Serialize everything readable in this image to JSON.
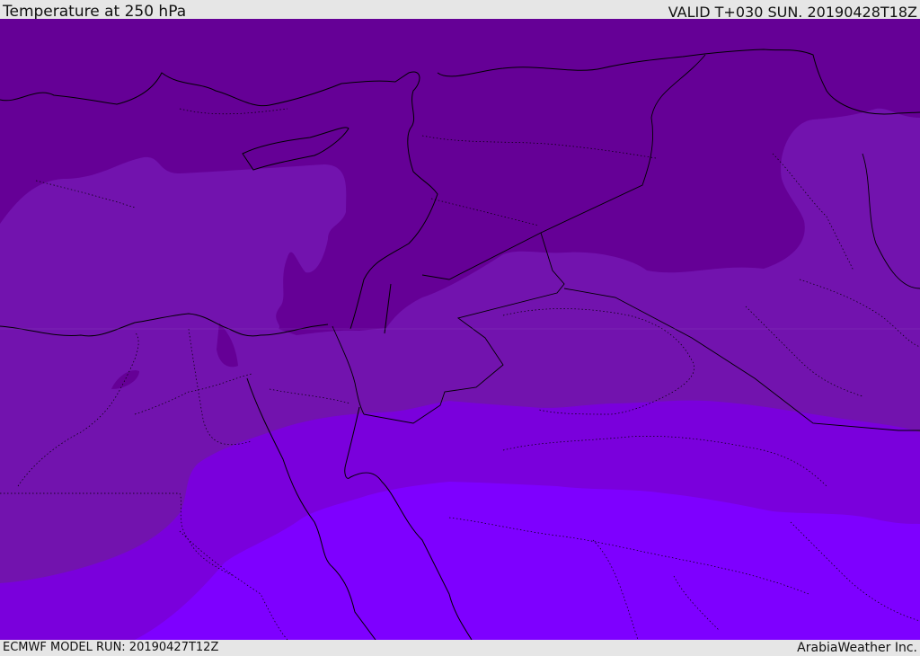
{
  "header": {
    "title": "Temperature at 250 hPa",
    "valid": "VALID T+030 SUN. 20190428T18Z"
  },
  "footer": {
    "model_run": "ECMWF MODEL RUN: 20190427T12Z",
    "credit": "ArabiaWeather Inc."
  },
  "colors": {
    "band_coldest": "#650096",
    "band_cold": "#7213ae",
    "band_mid": "#7a00dc",
    "band_warm": "#7e00ff",
    "lines": "#000000"
  }
}
